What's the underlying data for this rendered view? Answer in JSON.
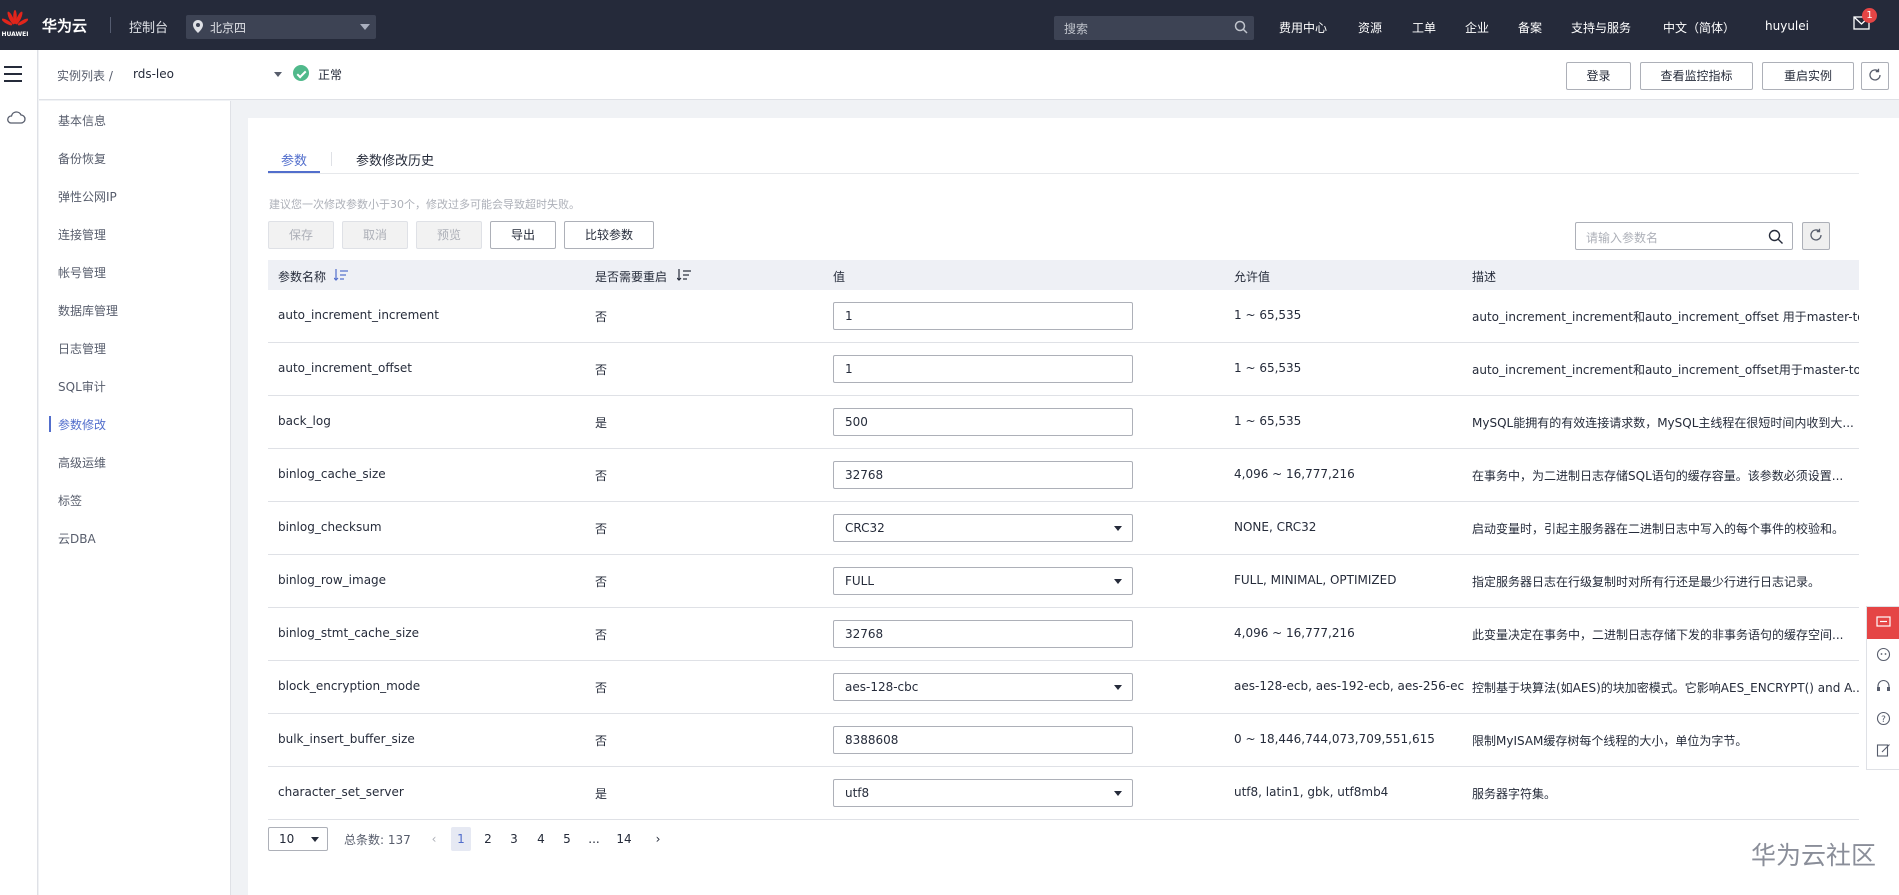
{
  "topbar": {
    "logo_text": "HUAWEI",
    "brand": "华为云",
    "console": "控制台",
    "region": "北京四",
    "search_placeholder": "搜索",
    "nav": [
      "费用中心",
      "资源",
      "工单",
      "企业",
      "备案",
      "支持与服务",
      "中文（简体）",
      "huyulei"
    ],
    "mail_badge": "1"
  },
  "header": {
    "breadcrumb_parent": "实例列表",
    "breadcrumb_sep": "/",
    "instance": "rds-leo",
    "status": "正常",
    "buttons": [
      "登录",
      "查看监控指标",
      "重启实例"
    ]
  },
  "sidebar": {
    "items": [
      {
        "label": "基本信息",
        "active": false
      },
      {
        "label": "备份恢复",
        "active": false
      },
      {
        "label": "弹性公网IP",
        "active": false
      },
      {
        "label": "连接管理",
        "active": false
      },
      {
        "label": "帐号管理",
        "active": false
      },
      {
        "label": "数据库管理",
        "active": false
      },
      {
        "label": "日志管理",
        "active": false
      },
      {
        "label": "SQL审计",
        "active": false
      },
      {
        "label": "参数修改",
        "active": true
      },
      {
        "label": "高级运维",
        "active": false
      },
      {
        "label": "标签",
        "active": false
      },
      {
        "label": "云DBA",
        "active": false
      }
    ]
  },
  "main": {
    "tabs": [
      {
        "label": "参数",
        "active": true
      },
      {
        "label": "参数修改历史",
        "active": false
      }
    ],
    "hint": "建议您一次修改参数小于30个，修改过多可能会导致超时失败。",
    "actions": [
      {
        "label": "保存",
        "disabled": true
      },
      {
        "label": "取消",
        "disabled": true
      },
      {
        "label": "预览",
        "disabled": true
      },
      {
        "label": "导出",
        "disabled": false
      },
      {
        "label": "比较参数",
        "disabled": false
      }
    ],
    "search_placeholder": "请输入参数名",
    "columns": [
      "参数名称",
      "是否需要重启",
      "值",
      "允许值",
      "描述"
    ],
    "rows": [
      {
        "name": "auto_increment_increment",
        "restart": "否",
        "value": "1",
        "type": "input",
        "allowed": "1 ~ 65,535",
        "desc": "auto_increment_increment和auto_increment_offset 用于master-to-..."
      },
      {
        "name": "auto_increment_offset",
        "restart": "否",
        "value": "1",
        "type": "input",
        "allowed": "1 ~ 65,535",
        "desc": "auto_increment_increment和auto_increment_offset用于master-to-..."
      },
      {
        "name": "back_log",
        "restart": "是",
        "value": "500",
        "type": "input",
        "allowed": "1 ~ 65,535",
        "desc": "MySQL能拥有的有效连接请求数，MySQL主线程在很短时间内收到大..."
      },
      {
        "name": "binlog_cache_size",
        "restart": "否",
        "value": "32768",
        "type": "input",
        "allowed": "4,096 ~ 16,777,216",
        "desc": "在事务中，为二进制日志存储SQL语句的缓存容量。该参数必须设置..."
      },
      {
        "name": "binlog_checksum",
        "restart": "否",
        "value": "CRC32",
        "type": "select",
        "allowed": "NONE, CRC32",
        "desc": "启动变量时，引起主服务器在二进制日志中写入的每个事件的校验和。"
      },
      {
        "name": "binlog_row_image",
        "restart": "否",
        "value": "FULL",
        "type": "select",
        "allowed": "FULL, MINIMAL, OPTIMIZED",
        "desc": "指定服务器日志在行级复制时对所有行还是最少行进行日志记录。"
      },
      {
        "name": "binlog_stmt_cache_size",
        "restart": "否",
        "value": "32768",
        "type": "input",
        "allowed": "4,096 ~ 16,777,216",
        "desc": "此变量决定在事务中，二进制日志存储下发的非事务语句的缓存空间..."
      },
      {
        "name": "block_encryption_mode",
        "restart": "否",
        "value": "aes-128-cbc",
        "type": "select",
        "allowed": "aes-128-ecb, aes-192-ecb, aes-256-ec...",
        "desc": "控制基于块算法(如AES)的块加密模式。它影响AES_ENCRYPT() and A..."
      },
      {
        "name": "bulk_insert_buffer_size",
        "restart": "否",
        "value": "8388608",
        "type": "input",
        "allowed": "0 ~ 18,446,744,073,709,551,615",
        "desc": "限制MyISAM缓存树每个线程的大小，单位为字节。"
      },
      {
        "name": "character_set_server",
        "restart": "是",
        "value": "utf8",
        "type": "select",
        "allowed": "utf8, latin1, gbk, utf8mb4",
        "desc": "服务器字符集。"
      }
    ],
    "pagination": {
      "page_size": "10",
      "total": "总条数: 137",
      "pages": [
        "1",
        "2",
        "3",
        "4",
        "5",
        "...",
        "14"
      ],
      "current": "1"
    }
  },
  "watermark": "华为云社区",
  "colors": {
    "accent": "#526ecc",
    "topbar": "#252a3a",
    "status_ok": "#50b98b",
    "alert": "#e54545"
  }
}
